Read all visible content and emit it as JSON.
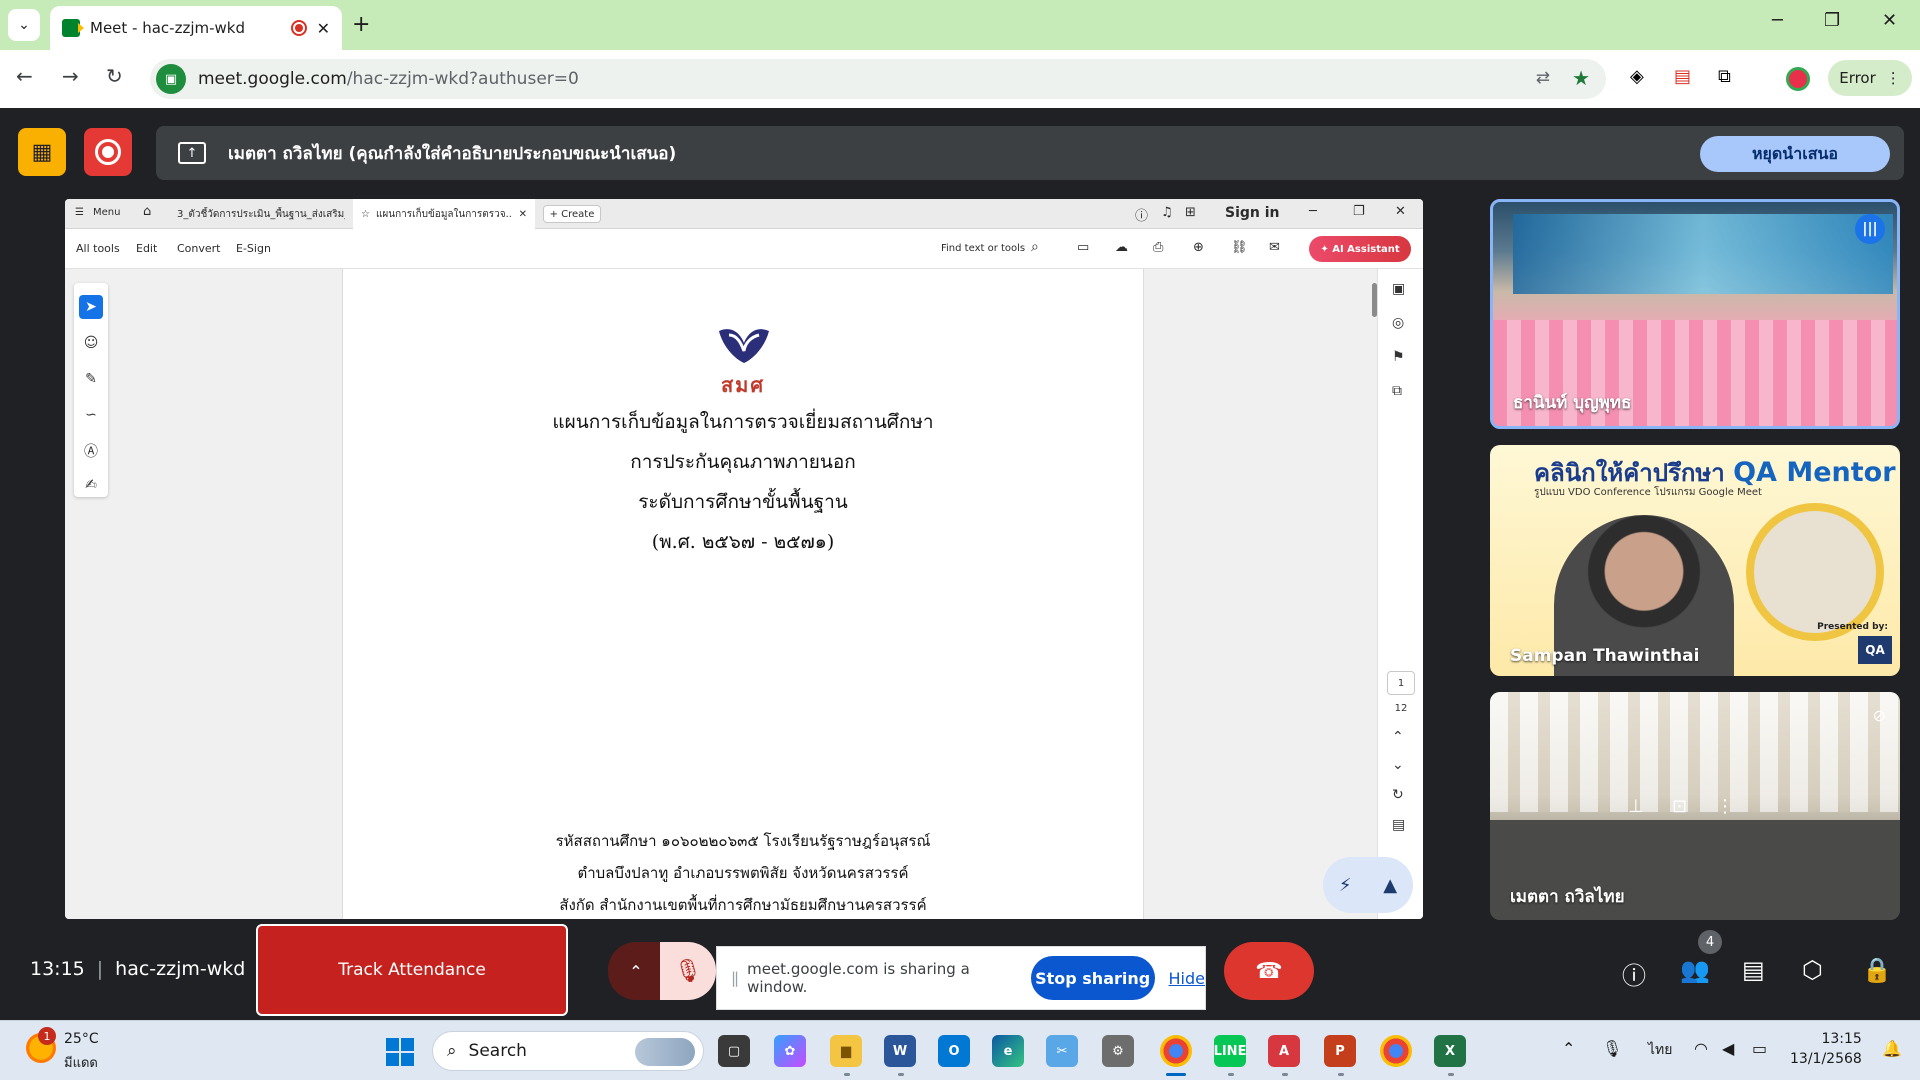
{
  "browser": {
    "tab_title": "Meet - hac-zzjm-wkd",
    "url_host": "meet.google.com",
    "url_path": "/hac-zzjm-wkd?authuser=0",
    "profile_status": "Error"
  },
  "meet": {
    "banner_text": "เมตตา ถวิลไทย (คุณกำลังใส่คำอธิบายประกอบขณะนำเสนอ)",
    "stop_present_label": "หยุดนำเสนอ",
    "time": "13:15",
    "meeting_code": "hac-zzjm-wkd",
    "track_attendance_label": "Track Attendance",
    "sharing_text": "meet.google.com is sharing a window.",
    "stop_sharing_label": "Stop sharing",
    "hide_label": "Hide",
    "people_count": "4",
    "participants": [
      {
        "name": "ธานินท์ บุญพุทธ",
        "speaking": true
      },
      {
        "name": "Sampan Thawinthai",
        "speaking": false
      },
      {
        "name": "เมตตา ถวิลไทย",
        "speaking": false
      }
    ],
    "tile2": {
      "title_thai": "คลินิกให้คำปรึกษา",
      "title_en": "QA Mentor",
      "subtitle": "รูปแบบ VDO Conference โปรแกรม Google Meet",
      "presented_by": "Presented by:",
      "logo": "QA"
    }
  },
  "acrobat": {
    "menu_label": "Menu",
    "tab1_title": "3_ตัวชี้วัดการประเมิน_พื้นฐาน_ส่งเสริม_...",
    "tab2_title": "แผนการเก็บข้อมูลในการตรวจ...",
    "create_label": "Create",
    "sign_in_label": "Sign in",
    "menu_items": [
      "All tools",
      "Edit",
      "Convert",
      "E-Sign"
    ],
    "find_placeholder": "Find text or tools",
    "ai_assistant_label": "AI Assistant",
    "page_current": "1",
    "page_total": "12"
  },
  "document": {
    "logo_text": "สมศ",
    "title_lines": [
      "แผนการเก็บข้อมูลในการตรวจเยี่ยมสถานศึกษา",
      "การประกันคุณภาพภายนอก",
      "ระดับการศึกษาขั้นพื้นฐาน",
      "(พ.ศ. ๒๕๖๗ - ๒๕๗๑)"
    ],
    "footer_lines": [
      "รหัสสถานศึกษา ๑๐๖๐๒๒๐๖๓๕ โรงเรียนรัฐราษฎร์อนุสรณ์",
      "ตำบลบึงปลาทู อำเภอบรรพตพิสัย จังหวัดนครสวรรค์",
      "สังกัด สำนักงานเขตพื้นที่การศึกษามัธยมศึกษานครสวรรค์"
    ]
  },
  "taskbar": {
    "weather_alert": "1",
    "temperature": "25°C",
    "condition": "มีแดด",
    "search_label": "Search",
    "language": "ไทย",
    "clock_time": "13:15",
    "clock_date": "13/1/2568"
  }
}
